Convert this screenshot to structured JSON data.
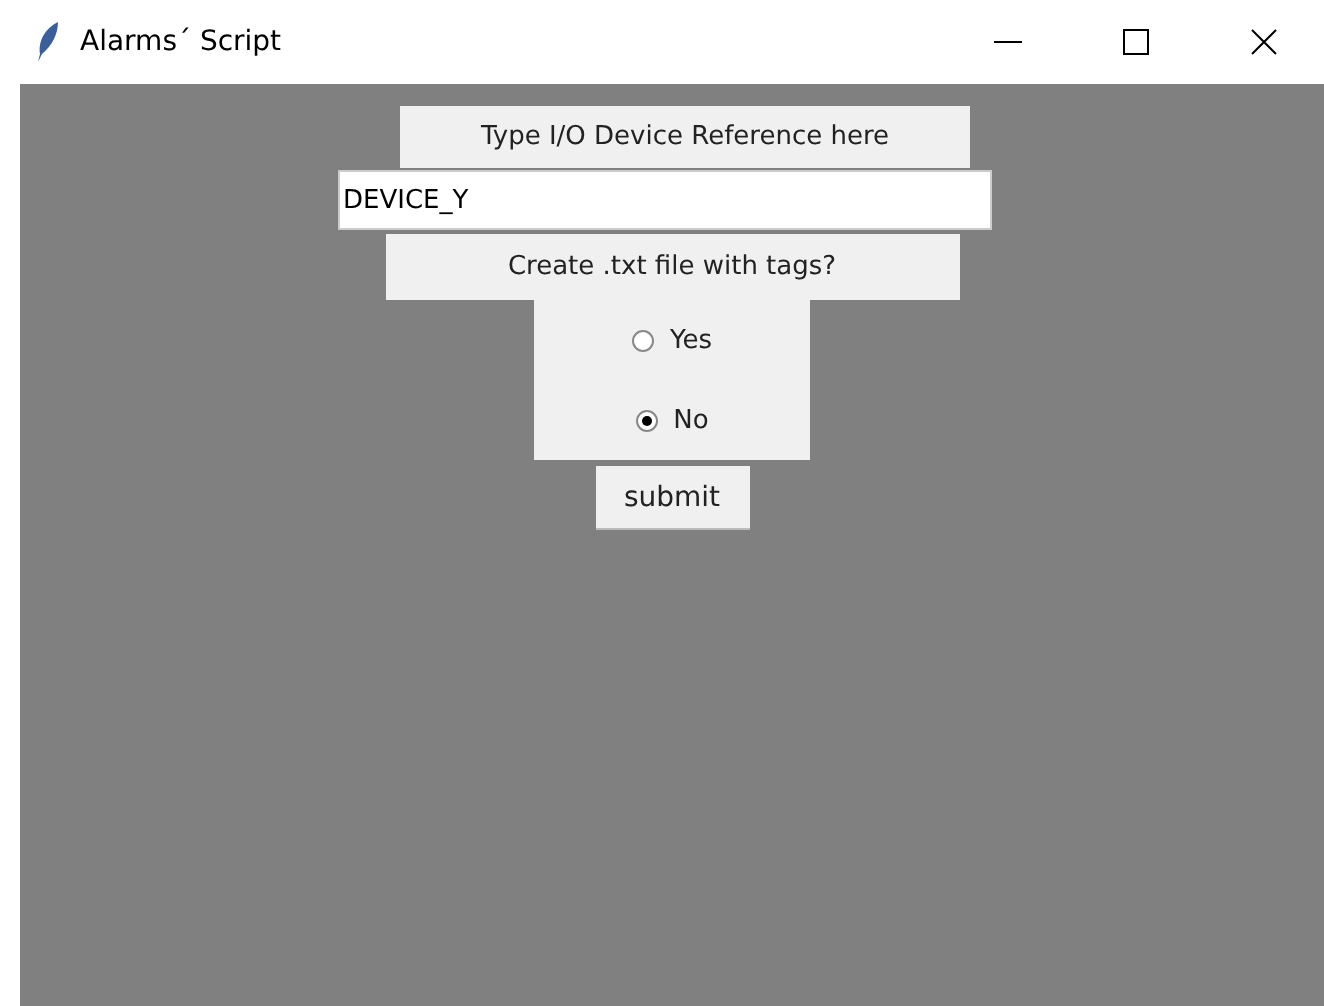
{
  "window": {
    "title": "Alarms´ Script"
  },
  "device_label": "Type I/O Device Reference here",
  "device_field": {
    "value": "DEVICE_Y"
  },
  "question": "Create .txt file with tags?",
  "options": [
    {
      "label": "Yes",
      "selected": false
    },
    {
      "label": "No",
      "selected": true
    }
  ],
  "submit_button": "submit"
}
